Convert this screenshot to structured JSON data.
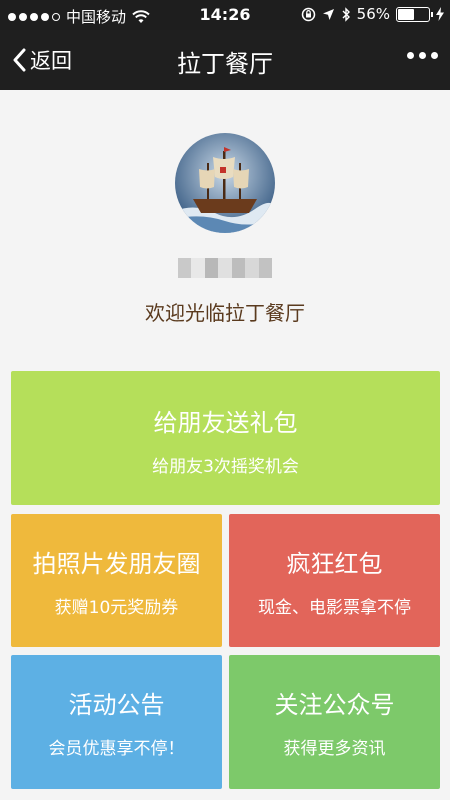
{
  "status_bar": {
    "carrier": "中国移动",
    "time": "14:26",
    "battery": "56%",
    "battery_level": 0.56
  },
  "nav": {
    "back_label": "返回",
    "title": "拉丁餐厅"
  },
  "profile": {
    "welcome": "欢迎光临拉丁餐厅"
  },
  "tiles": {
    "gift": {
      "title": "给朋友送礼包",
      "sub": "给朋友3次摇奖机会",
      "color": "#b5df5a"
    },
    "photo": {
      "title": "拍照片发朋友圈",
      "sub": "获赠10元奖励券",
      "color": "#efb93c"
    },
    "redpack": {
      "title": "疯狂红包",
      "sub": "现金、电影票拿不停",
      "color": "#e2655a"
    },
    "activity": {
      "title": "活动公告",
      "sub": "会员优惠享不停！",
      "color": "#5db0e4"
    },
    "follow": {
      "title": "关注公众号",
      "sub": "获得更多资讯",
      "color": "#7dc96a"
    }
  }
}
